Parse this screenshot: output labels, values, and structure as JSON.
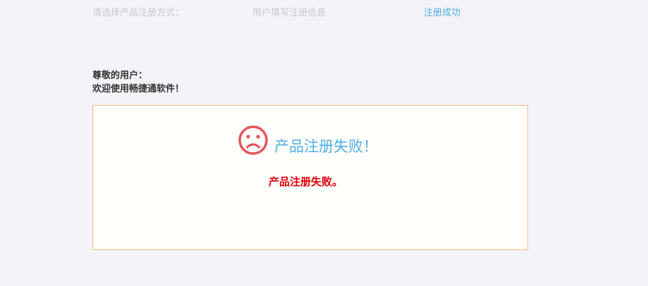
{
  "steps": {
    "step1": "请选择产品注册方式：",
    "step2": "用户填写注册信息",
    "step3": "注册成功"
  },
  "greeting": {
    "line1": "尊敬的用户：",
    "line2": "欢迎使用畅捷通软件！"
  },
  "result": {
    "icon": "sad-face-icon",
    "title": "产品注册失败！",
    "message": "产品注册失败。"
  },
  "colors": {
    "background": "#f4f3f8",
    "step_inactive": "#c8c8cc",
    "step_active": "#4eaee4",
    "box_border": "#f5bc7e",
    "icon": "#e8545a",
    "title": "#4eaee4",
    "message": "#e0000a"
  }
}
